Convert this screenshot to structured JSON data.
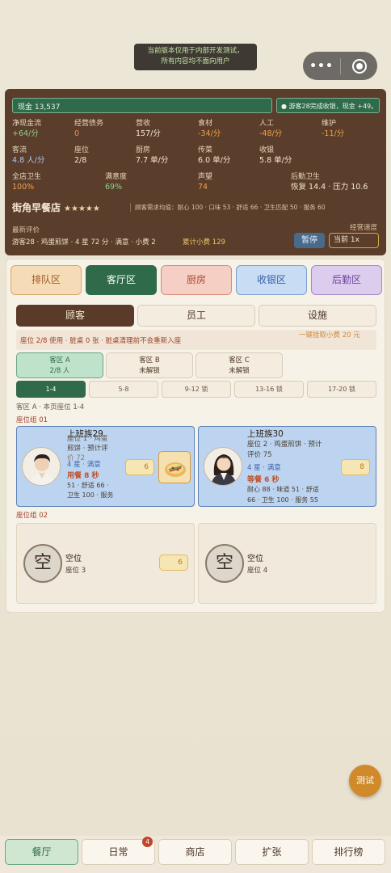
{
  "notice": {
    "line1": "当前版本仅用于内部开发测试，",
    "line2": "所有内容均不面向用户"
  },
  "capsule": {
    "menu_glyph": "•••"
  },
  "dashboard": {
    "cash": "现金 13,537",
    "toast": "● 游客28完成收银，现金 +49。",
    "stats": [
      {
        "label": "净现金流",
        "value": "+64/分"
      },
      {
        "label": "经营债务",
        "value": "0"
      },
      {
        "label": "营收",
        "value": "157/分"
      },
      {
        "label": "食材",
        "value": "-34/分"
      },
      {
        "label": "人工",
        "value": "-48/分"
      },
      {
        "label": "维护",
        "value": "-11/分"
      },
      {
        "label": "客流",
        "value": "4.8 人/分"
      },
      {
        "label": "座位",
        "value": "2/8"
      },
      {
        "label": "厨房",
        "value": "7.7 单/分"
      },
      {
        "label": "传菜",
        "value": "6.0 单/分"
      },
      {
        "label": "收银",
        "value": "5.8 单/分"
      },
      {
        "label": "全店卫生",
        "value": "100%"
      },
      {
        "label": "满意度",
        "value": "69%"
      },
      {
        "label": "声望",
        "value": "74"
      },
      {
        "label": "后勤卫生",
        "value": "恢复 14.4 · 压力 10.6"
      }
    ],
    "shop_name": "街角早餐店",
    "stars": "★★★★★",
    "demand": "顾客需求均值：耐心 100 · 口味 53 · 舒适 66 · 卫生匹配 50 · 服务 60",
    "review_label": "最新评价",
    "review": "游客28 · 鸡蛋煎饼 · 4 星 72 分 · 满意 · 小费 2",
    "tips": "累计小费 129",
    "speed_label": "经营速度",
    "pause": "暂停",
    "speed": "当前 1x"
  },
  "zones": [
    "排队区",
    "客厅区",
    "厨房",
    "收银区",
    "后勤区"
  ],
  "subtabs": [
    "顾客",
    "员工",
    "设施"
  ],
  "seat_bar": {
    "info": "座位 2/8 使用 · 脏桌 0 张 · 脏桌清理前不会重新入座",
    "collect": "一键拾取小费 20 元"
  },
  "areas": [
    {
      "name": "客区 A",
      "sub": "2/8 人"
    },
    {
      "name": "客区 B",
      "sub": "未解锁"
    },
    {
      "name": "客区 C",
      "sub": "未解锁"
    }
  ],
  "pages": [
    "1-4",
    "5-8",
    "9-12 锁",
    "13-16 锁",
    "17-20 锁"
  ],
  "page_caption": "客区 A · 本页座位 1-4",
  "groups": [
    "座位组 01",
    "座位组 02"
  ],
  "customers": [
    {
      "name": "上班族29",
      "line1": "座位 1 · 鸡蛋",
      "line2": "煎饼 · 预计评",
      "line3": "价 72",
      "status": "4 星 · 满意",
      "wait": "用餐 8 秒",
      "stats1": "51 · 舒适 66 ·",
      "stats2": "卫生 100 · 服务",
      "tag": "6"
    },
    {
      "name": "上班族30",
      "line1": "座位 2 · 鸡蛋煎饼 · 预计",
      "line2": "评价 75",
      "status": "4 星 · 满意",
      "wait": "等餐 6 秒",
      "stats1": "耐心 88 · 味道 51 · 舒适",
      "stats2": "66 · 卫生 100 · 服务 55",
      "tag": "8"
    }
  ],
  "empty_seats": [
    {
      "glyph": "空",
      "name": "空位",
      "sub": "座位 3",
      "tag": "6"
    },
    {
      "glyph": "空",
      "name": "空位",
      "sub": "座位 4"
    }
  ],
  "test_button": "测试",
  "nav": [
    {
      "label": "餐厅"
    },
    {
      "label": "日常",
      "badge": "4"
    },
    {
      "label": "商店"
    },
    {
      "label": "扩张"
    },
    {
      "label": "排行榜"
    }
  ]
}
